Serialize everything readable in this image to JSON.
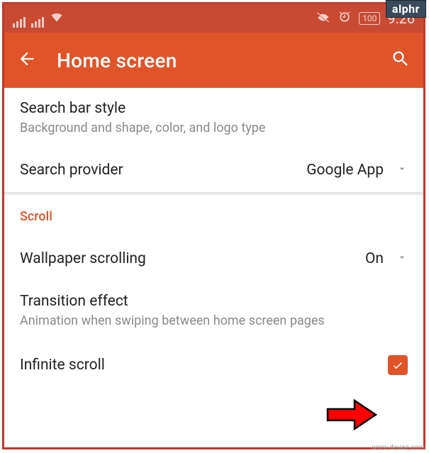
{
  "colors": {
    "accent": "#e0542a",
    "status_bg": "#c94a33"
  },
  "status": {
    "battery": "100",
    "time": "9:26"
  },
  "header": {
    "title": "Home screen"
  },
  "rows": {
    "search_bar_style": {
      "title": "Search bar style",
      "subtitle": "Background and shape, color, and logo type"
    },
    "search_provider": {
      "title": "Search provider",
      "value": "Google App"
    },
    "scroll_section": "Scroll",
    "wallpaper_scrolling": {
      "title": "Wallpaper scrolling",
      "value": "On"
    },
    "transition_effect": {
      "title": "Transition effect",
      "subtitle": "Animation when swiping between home screen pages"
    },
    "infinite_scroll": {
      "title": "Infinite scroll",
      "checked": true
    }
  },
  "badge": "alphr",
  "watermark": "www.deuaq.com"
}
